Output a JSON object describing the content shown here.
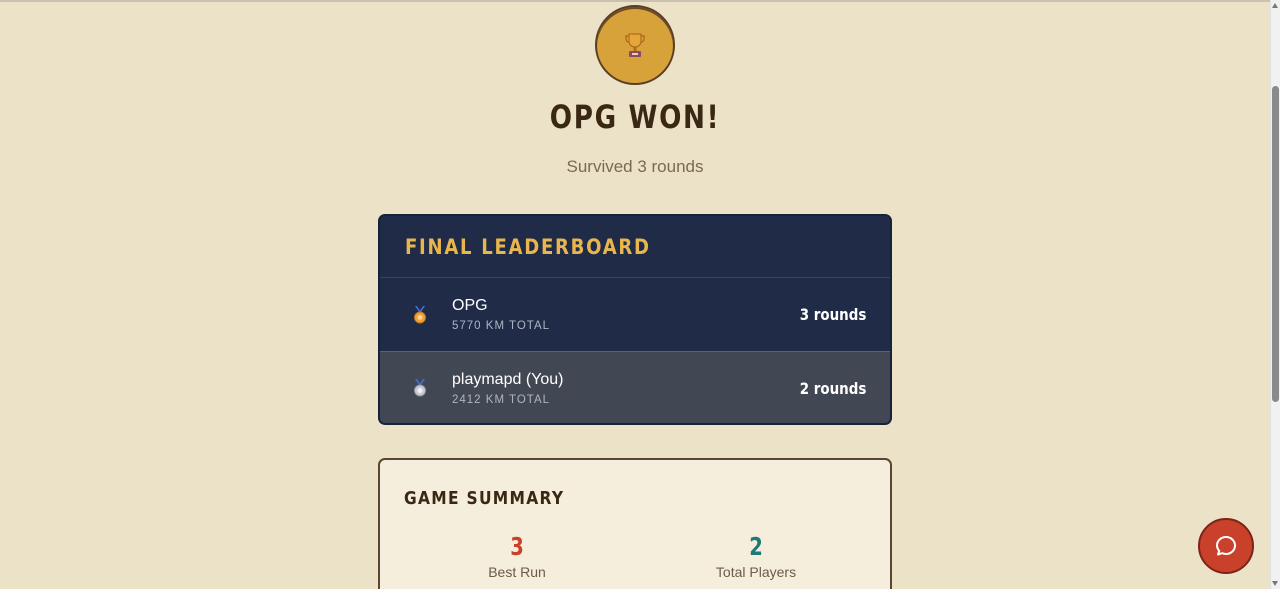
{
  "result": {
    "title": "OPG WON!",
    "subtitle": "Survived 3 rounds",
    "trophy_icon": "trophy-icon"
  },
  "leaderboard": {
    "title": "FINAL LEADERBOARD",
    "rows": [
      {
        "name": "OPG",
        "km": "5770 KM TOTAL",
        "rounds": "3 rounds",
        "medal": "gold-medal-icon"
      },
      {
        "name": "playmapd (You)",
        "km": "2412 KM TOTAL",
        "rounds": "2 rounds",
        "medal": "silver-medal-icon"
      }
    ]
  },
  "summary": {
    "title": "GAME SUMMARY",
    "stats": [
      {
        "value": "3",
        "label": "Best Run",
        "color": "#c8412b"
      },
      {
        "value": "2",
        "label": "Total Players",
        "color": "#1e7a78"
      }
    ]
  },
  "chat": {
    "icon": "chat-bubble-icon"
  },
  "colors": {
    "background": "#ece2c8",
    "panel_dark": "#202b47",
    "accent_gold": "#e8b64d",
    "accent_red": "#c9412b",
    "accent_teal": "#1e7a78"
  }
}
